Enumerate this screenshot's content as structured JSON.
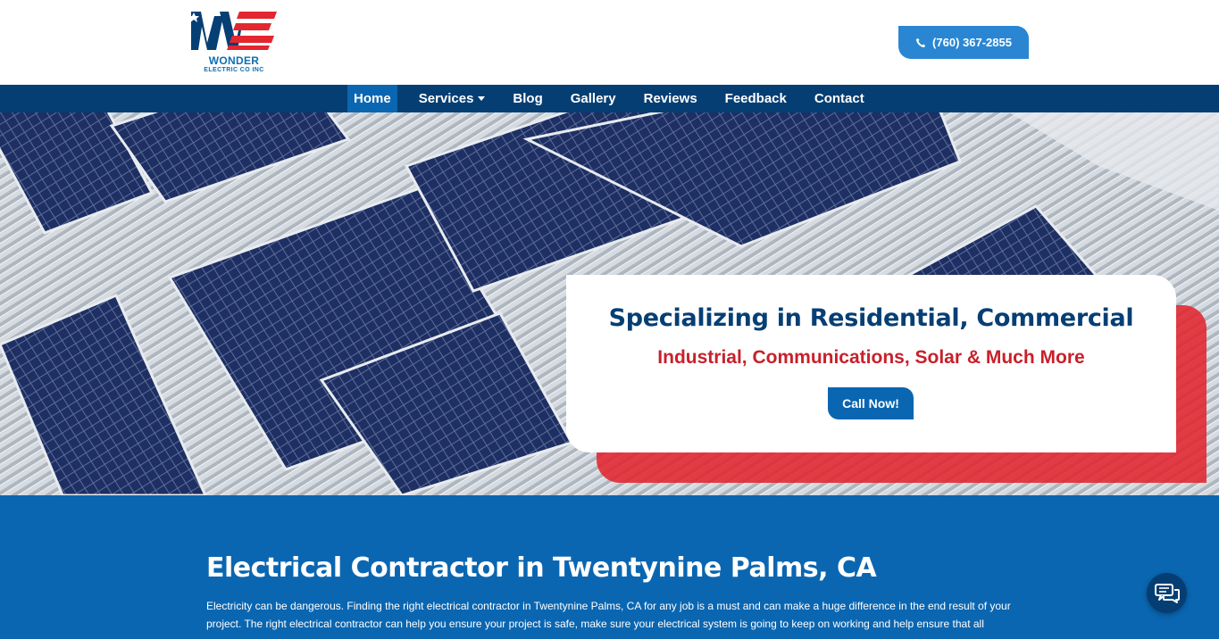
{
  "header": {
    "logo": {
      "name": "WONDER",
      "subtitle": "ELECTRIC CO INC"
    },
    "phone": {
      "label": "(760) 367-2855",
      "icon": "phone-icon"
    }
  },
  "nav": {
    "items": [
      {
        "label": "Home",
        "active": true
      },
      {
        "label": "Services",
        "dropdown": true
      },
      {
        "label": "Blog"
      },
      {
        "label": "Gallery"
      },
      {
        "label": "Reviews"
      },
      {
        "label": "Feedback"
      },
      {
        "label": "Contact"
      }
    ]
  },
  "hero": {
    "title": "Specializing in Residential, Commercial",
    "subtitle": "Industrial, Communications, Solar & Much More",
    "cta": "Call Now!"
  },
  "content": {
    "heading": "Electrical Contractor in Twentynine Palms, CA",
    "paragraph": "Electricity can be dangerous. Finding the right electrical contractor in Twentynine Palms, CA for any job is a must and can make a huge difference in the end result of your project. The right electrical contractor can help you ensure your project is safe, make sure your electrical system is going to keep on working and help ensure that all"
  },
  "chat": {
    "icon": "chat-icon"
  },
  "colors": {
    "brand_blue": "#0a66b1",
    "nav_dark": "#053e73",
    "accent_red": "#c8202b",
    "phone_blue": "#2a86d3"
  }
}
